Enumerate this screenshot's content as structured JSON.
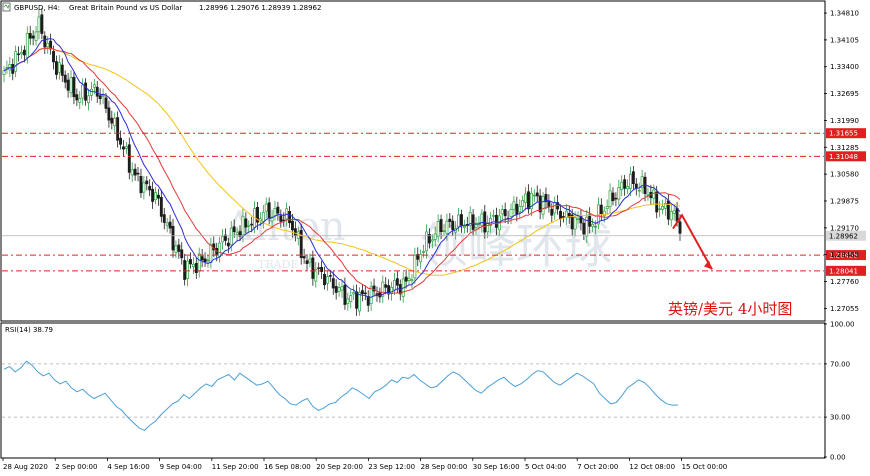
{
  "header": {
    "symbol": "GBPUSD, H4:",
    "description": "Great Britain Pound vs US Dollar",
    "ohlc": "1.28996 1.29076 1.28939 1.28962"
  },
  "caption": "英镑/美元  4小时图",
  "watermark": {
    "brand": "Anton",
    "brand_cn": "领峰环球",
    "sub": "TRADE"
  },
  "colors": {
    "bull": "#2ea043",
    "bear": "#d11",
    "ma_fast": "#2d2dd6",
    "ma_mid": "#e23a3a",
    "ma_slow": "#f0c419",
    "rsi": "#4a9fd8",
    "level": "#e02020",
    "arrow": "#e02020",
    "current": "#b0b0b0"
  },
  "chart_data": [
    {
      "type": "candlestick",
      "ylim": [
        1.2675,
        1.351
      ],
      "x_tick_labels": [
        "28 Aug 2020",
        "2 Sep 00:00",
        "4 Sep 16:00",
        "9 Sep 04:00",
        "11 Sep 20:00",
        "16 Sep 08:00",
        "20 Sep 20:00",
        "23 Sep 12:00",
        "28 Sep 00:00",
        "30 Sep 16:00",
        "5 Oct 04:00",
        "7 Oct 20:00",
        "12 Oct 08:00",
        "15 Oct 00:00"
      ],
      "y_ticks": [
        1.3481,
        1.34105,
        1.334,
        1.32695,
        1.3199,
        1.31285,
        1.3058,
        1.29875,
        1.2917,
        1.28465,
        1.2776,
        1.27055
      ],
      "levels": [
        {
          "value": 1.31655,
          "label": "1.31655"
        },
        {
          "value": 1.31048,
          "label": "1.31048"
        },
        {
          "value": 1.28455,
          "label": "1.28455"
        },
        {
          "value": 1.28041,
          "label": "1.28041"
        }
      ],
      "current_price": {
        "value": 1.28962,
        "label": "1.28962"
      },
      "close_path": [
        [
          0,
          1.332
        ],
        [
          6,
          1.338
        ],
        [
          12,
          1.345
        ],
        [
          14,
          1.341
        ],
        [
          18,
          1.334
        ],
        [
          25,
          1.326
        ],
        [
          32,
          1.328
        ],
        [
          38,
          1.318
        ],
        [
          45,
          1.305
        ],
        [
          52,
          1.3
        ],
        [
          56,
          1.292
        ],
        [
          62,
          1.281
        ],
        [
          68,
          1.283
        ],
        [
          75,
          1.288
        ],
        [
          82,
          1.292
        ],
        [
          90,
          1.296
        ],
        [
          98,
          1.294
        ],
        [
          104,
          1.282
        ],
        [
          110,
          1.279
        ],
        [
          118,
          1.273
        ],
        [
          125,
          1.274
        ],
        [
          132,
          1.276
        ],
        [
          138,
          1.277
        ],
        [
          144,
          1.287
        ],
        [
          150,
          1.292
        ],
        [
          158,
          1.293
        ],
        [
          166,
          1.293
        ],
        [
          174,
          1.296
        ],
        [
          181,
          1.3
        ],
        [
          188,
          1.297
        ],
        [
          194,
          1.294
        ],
        [
          201,
          1.292
        ],
        [
          208,
          1.299
        ],
        [
          214,
          1.304
        ],
        [
          220,
          1.302
        ],
        [
          225,
          1.297
        ],
        [
          229,
          1.296
        ],
        [
          232,
          1.292
        ]
      ],
      "projection": {
        "from": 1.2915,
        "peak": 1.295,
        "to": 1.2808
      }
    },
    {
      "type": "line",
      "title": "RSI(14) 38.79",
      "ylim": [
        0,
        100
      ],
      "y_ticks": [
        100.0,
        70.0,
        30.0,
        0.0
      ],
      "reference_lines": [
        70,
        30
      ],
      "series": [
        {
          "values": [
            66,
            68,
            64,
            67,
            72,
            69,
            64,
            61,
            63,
            58,
            55,
            57,
            52,
            49,
            51,
            47,
            44,
            46,
            48,
            43,
            38,
            35,
            30,
            26,
            22,
            20,
            24,
            27,
            32,
            36,
            40,
            42,
            47,
            44,
            48,
            52,
            55,
            53,
            58,
            60,
            62,
            58,
            63,
            60,
            57,
            54,
            55,
            57,
            52,
            47,
            44,
            40,
            39,
            42,
            44,
            38,
            35,
            37,
            40,
            41,
            45,
            48,
            52,
            50,
            47,
            44,
            49,
            51,
            54,
            58,
            56,
            60,
            59,
            62,
            58,
            55,
            52,
            53,
            57,
            61,
            64,
            62,
            58,
            54,
            50,
            48,
            52,
            55,
            58,
            60,
            56,
            53,
            55,
            58,
            62,
            65,
            64,
            60,
            56,
            54,
            57,
            60,
            63,
            61,
            58,
            55,
            48,
            44,
            40,
            41,
            46,
            52,
            55,
            58,
            56,
            52,
            47,
            43,
            40,
            39,
            39
          ]
        }
      ]
    }
  ]
}
